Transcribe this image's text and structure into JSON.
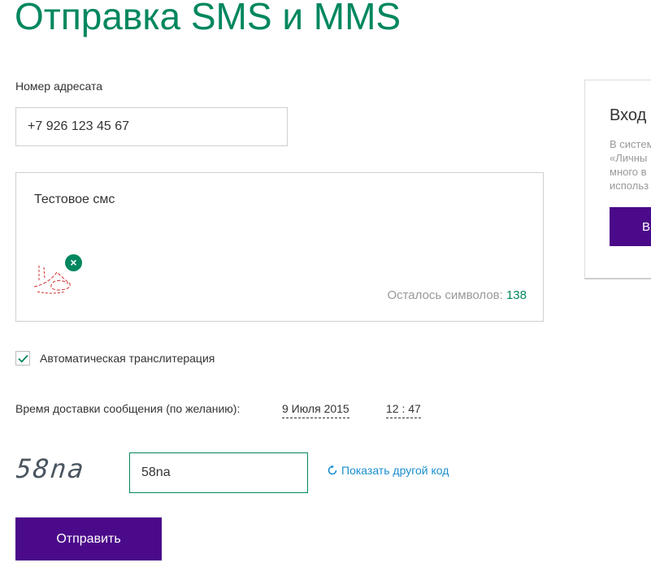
{
  "header": {
    "title": "Отправка SMS и MMS"
  },
  "recipient": {
    "label": "Номер адресата",
    "value": "+7 926 123 45 67"
  },
  "message": {
    "text": "Тестовое смс",
    "chars_left_label": "Осталось символов: ",
    "chars_left_count": "138",
    "attachment_icon": "sketch-image-icon",
    "remove_icon": "close-icon"
  },
  "translit": {
    "label": "Автоматическая транслитерация",
    "checked": true
  },
  "delivery": {
    "label": "Время доставки сообщения (по желанию):",
    "date": "9 Июля 2015",
    "time": "12 : 47"
  },
  "captcha": {
    "image_text": "58na",
    "input_value": "58na",
    "refresh_label": "Показать другой код",
    "refresh_icon": "refresh-icon"
  },
  "submit": {
    "label": "Отправить"
  },
  "login_panel": {
    "title": "Вход",
    "text_line1": "В систем",
    "text_line2": "«Личны",
    "text_line3": "много в",
    "text_line4": "использ",
    "button_label": "В"
  },
  "colors": {
    "brand_green": "#00875f",
    "brand_purple": "#4b0a8a",
    "link_blue": "#1a8ecf",
    "muted_gray": "#999999"
  }
}
